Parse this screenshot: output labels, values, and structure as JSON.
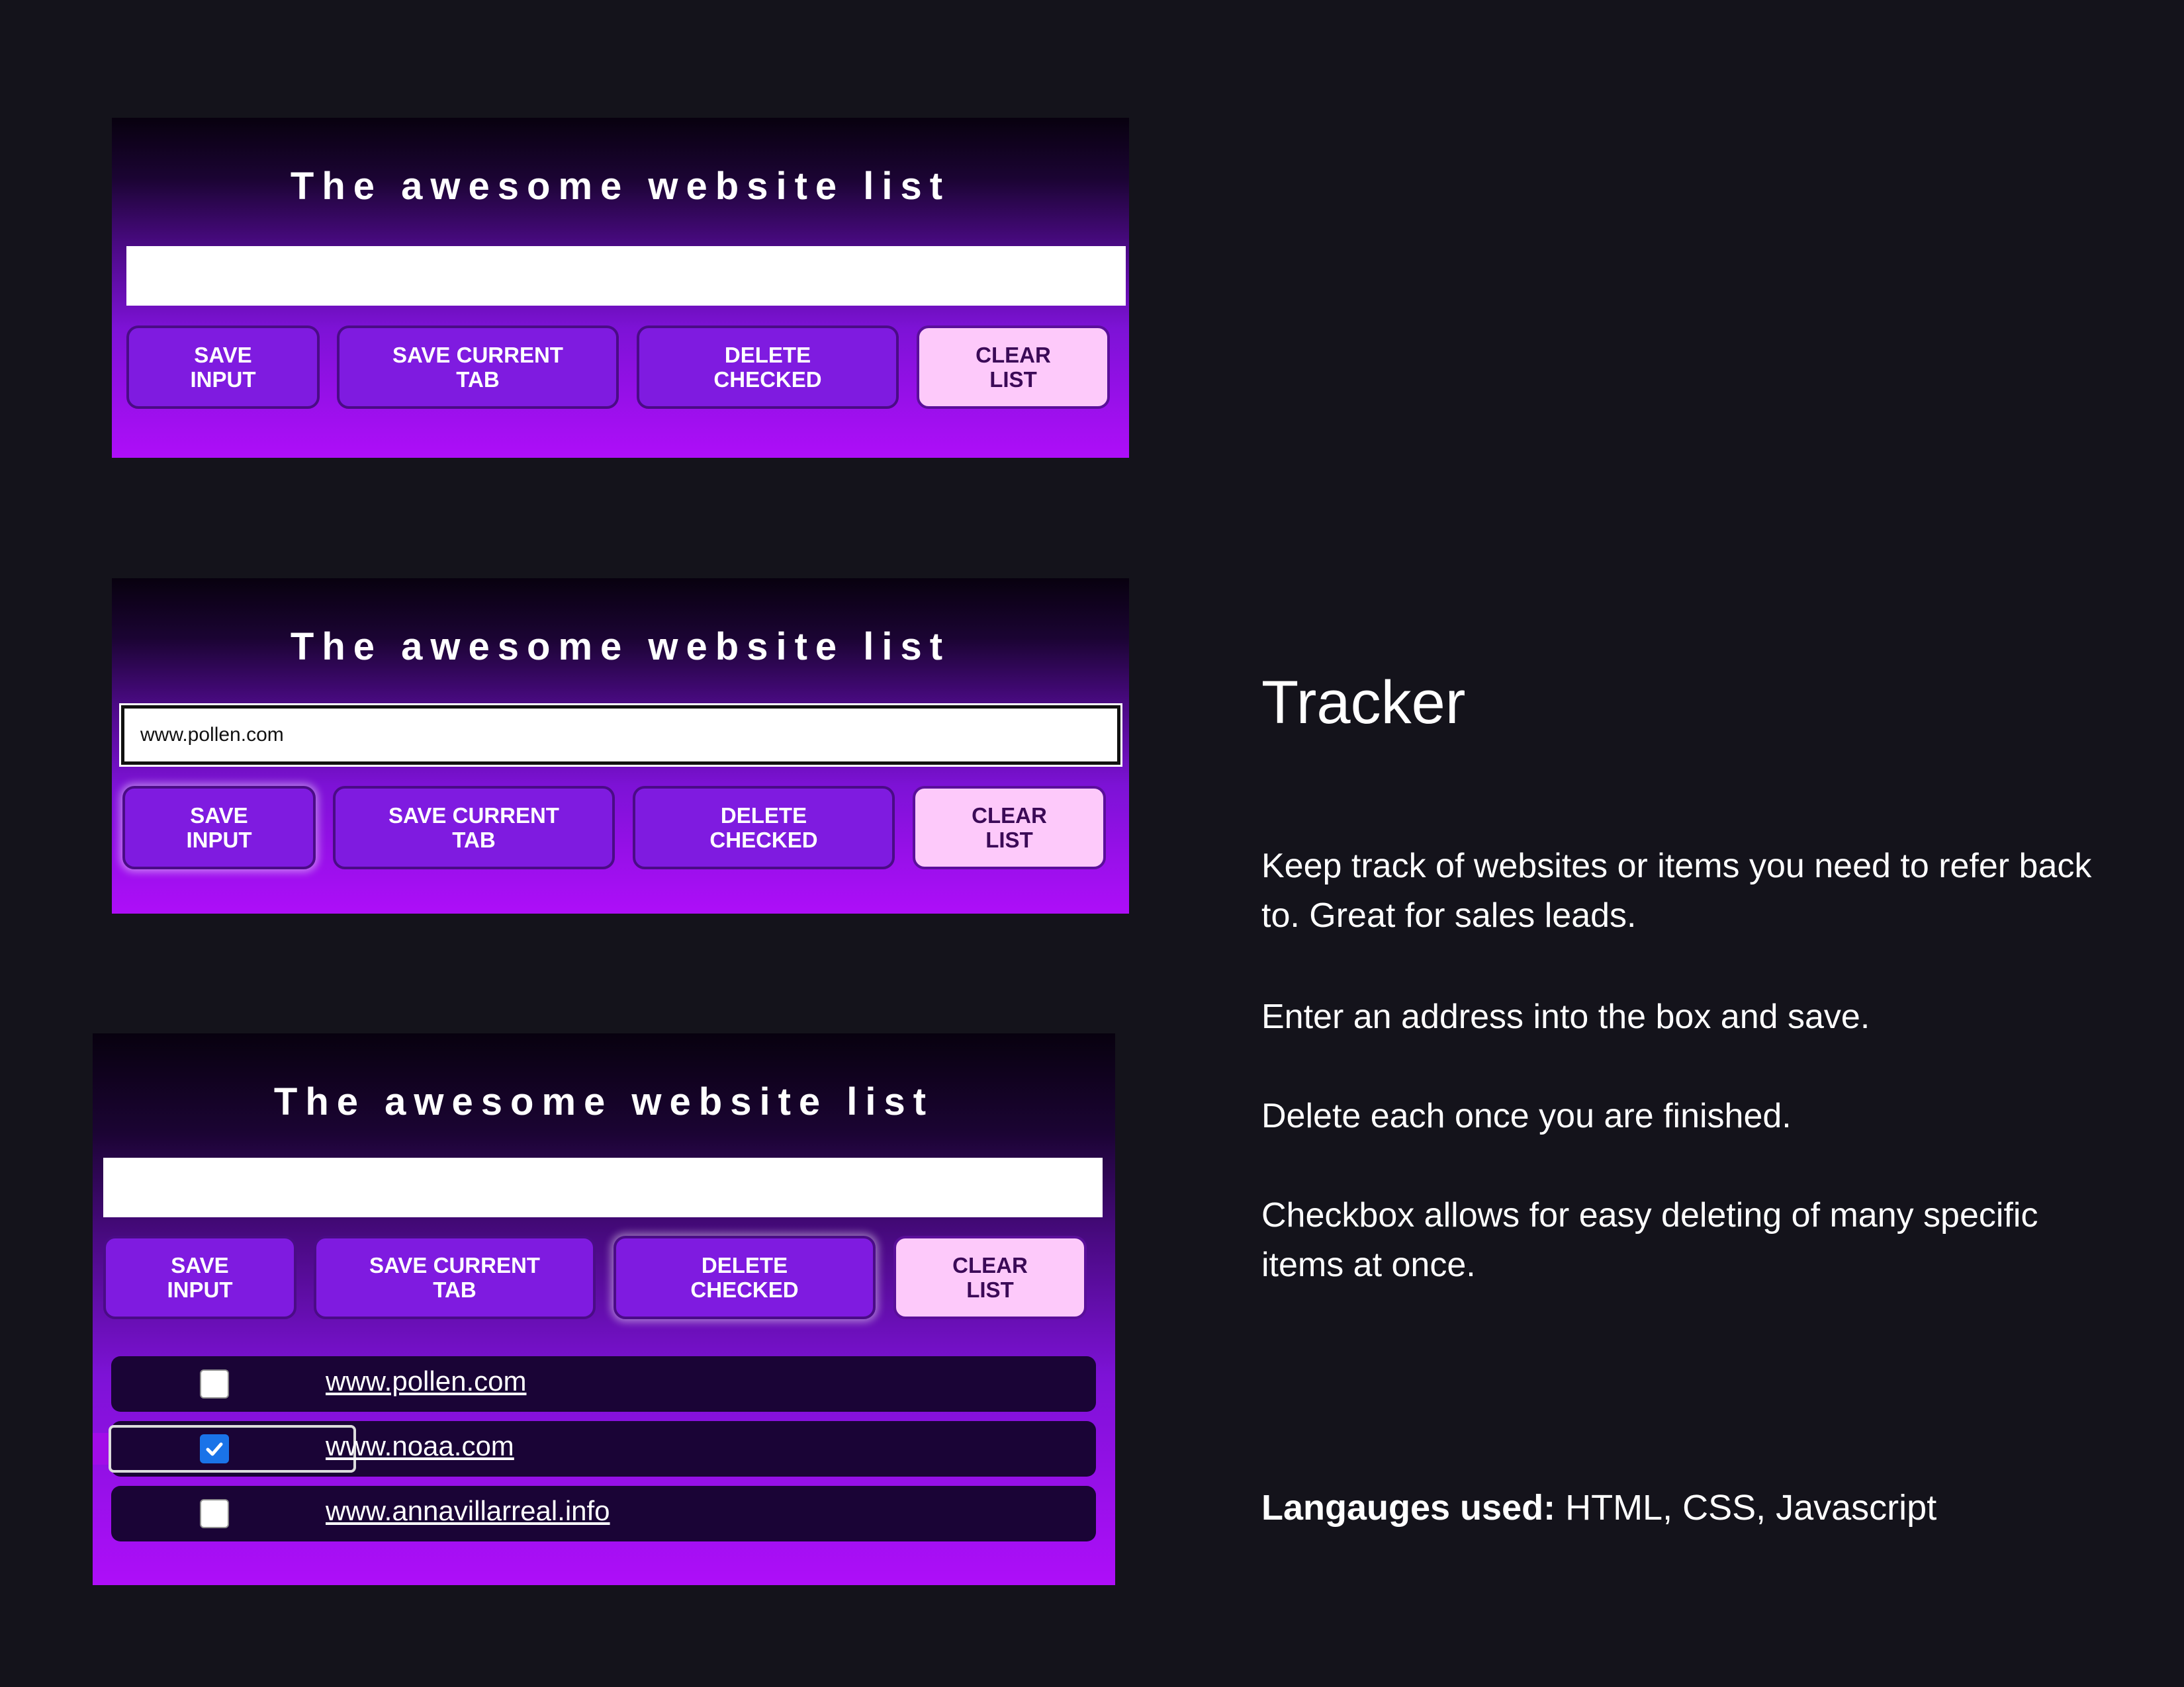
{
  "panels": [
    {
      "title": "The awesome website list",
      "input_value": "",
      "buttons": {
        "save_input": "SAVE\nINPUT",
        "save_current_tab": "SAVE CURRENT\nTAB",
        "delete_checked": "DELETE\nCHECKED",
        "clear_list": "CLEAR\nLIST"
      }
    },
    {
      "title": "The awesome website list",
      "input_value": "www.pollen.com",
      "buttons": {
        "save_input": "SAVE\nINPUT",
        "save_current_tab": "SAVE CURRENT\nTAB",
        "delete_checked": "DELETE\nCHECKED",
        "clear_list": "CLEAR\nLIST"
      }
    },
    {
      "title": "The awesome website list",
      "input_value": "",
      "buttons": {
        "save_input": "SAVE\nINPUT",
        "save_current_tab": "SAVE CURRENT\nTAB",
        "delete_checked": "DELETE\nCHECKED",
        "clear_list": "CLEAR\nLIST"
      },
      "list": [
        {
          "url": "www.pollen.com",
          "checked": false
        },
        {
          "url": "www.noaa.com",
          "checked": true
        },
        {
          "url": "www.annavillarreal.info",
          "checked": false
        }
      ]
    }
  ],
  "description": {
    "heading": "Tracker",
    "paragraphs": [
      "Keep track of websites or items you need to refer back to. Great for sales leads.",
      "Enter an address into the box and save.",
      "Delete each once you are finished.",
      "Checkbox allows for easy deleting of many specific items at once."
    ],
    "languages_label": "Langauges used:",
    "languages_value": " HTML, CSS, Javascript"
  },
  "colors": {
    "page_background": "#14131b",
    "button_purple": "#7f1be0",
    "clear_button_pink": "#fdc9fa",
    "row_background": "#1a0436",
    "checkbox_checked": "#1a73e8"
  }
}
